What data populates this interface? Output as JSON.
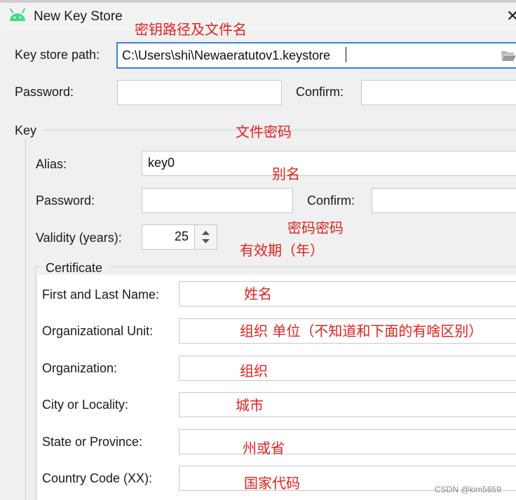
{
  "window": {
    "title": "New Key Store",
    "close_glyph": "✕"
  },
  "keystore": {
    "path_label": "Key store path:",
    "path_value": "C:\\Users\\shi\\Newaeratutov1.keystore",
    "password_label": "Password:",
    "confirm_label": "Confirm:"
  },
  "key": {
    "section_label": "Key",
    "alias_label": "Alias:",
    "alias_value": "key0",
    "password_label": "Password:",
    "confirm_label": "Confirm:",
    "validity_label": "Validity (years):",
    "validity_value": "25"
  },
  "certificate": {
    "section_label": "Certificate",
    "first_last_name_label": "First and Last Name:",
    "org_unit_label": "Organizational Unit:",
    "organization_label": "Organization:",
    "city_label": "City or Locality:",
    "state_label": "State or Province:",
    "country_label": "Country Code (XX):"
  },
  "annotations": {
    "keystore_path": "密钥路径及文件名",
    "file_password": "文件密码",
    "alias": "别名",
    "key_password": "密码密码",
    "validity": "有效期（年）",
    "name": "姓名",
    "org_unit": "组织 单位（不知道和下面的有啥区别）",
    "organization": "组织",
    "city": "城市",
    "state": "州或省",
    "country": "国家代码"
  },
  "watermark": "CSDN @kim5659",
  "colors": {
    "annotation": "#e0221e",
    "focus_border": "#3c7fd6",
    "android_green": "#3ddc84"
  }
}
